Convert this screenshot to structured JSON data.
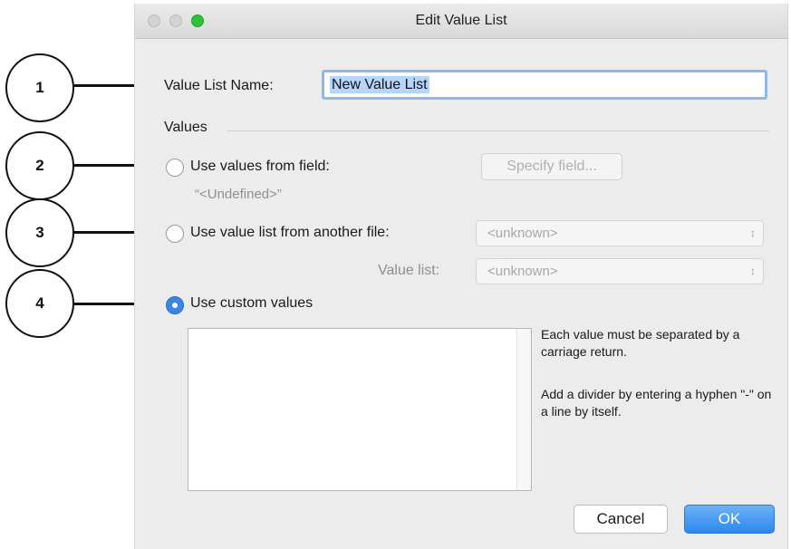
{
  "window": {
    "title": "Edit Value List"
  },
  "callouts": [
    "1",
    "2",
    "3",
    "4"
  ],
  "form": {
    "name_label": "Value List Name:",
    "name_value": "New Value List",
    "values_heading": "Values",
    "option_field": {
      "label": "Use values from field:",
      "button": "Specify field...",
      "field_value": "“<Undefined>”",
      "selected": false
    },
    "option_file": {
      "label": "Use value list from another file:",
      "file_select": "<unknown>",
      "value_list_label": "Value list:",
      "value_list_select": "<unknown>",
      "selected": false
    },
    "option_custom": {
      "label": "Use custom values",
      "selected": true,
      "textarea_value": ""
    },
    "help_1": "Each value must be separated by a carriage return.",
    "help_2": "Add a divider by entering a hyphen \"-\" on a line by itself."
  },
  "buttons": {
    "cancel": "Cancel",
    "ok": "OK"
  },
  "colors": {
    "accent": "#3a86e6",
    "ok_button": "#2f88ee",
    "focus_ring": "#8eb8ea"
  }
}
